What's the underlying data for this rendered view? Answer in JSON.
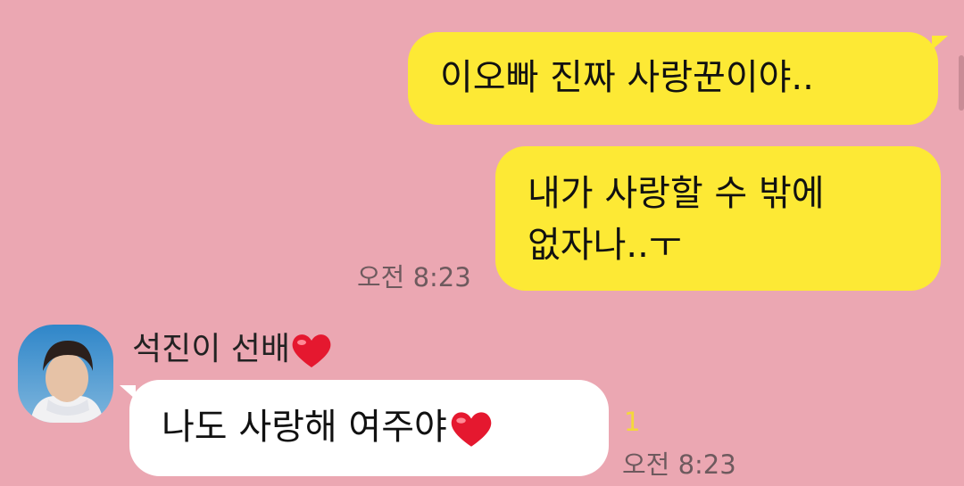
{
  "chat": {
    "background_color": "#eba7b2",
    "outgoing_bubble_color": "#fde935",
    "incoming_bubble_color": "#ffffff",
    "messages": [
      {
        "direction": "outgoing",
        "text": "이오빠 진짜 사랑꾼이야.."
      },
      {
        "direction": "outgoing",
        "line1": "내가 사랑할 수 밖에",
        "line2": "없자나..ㅜ",
        "time": "오전 8:23"
      },
      {
        "direction": "incoming",
        "sender": "석진이 선배",
        "sender_emoji": "heart-emoji",
        "text": "나도 사랑해 여주야",
        "text_emoji": "heart-emoji",
        "unread": "1",
        "time": "오전 8:23"
      }
    ]
  }
}
